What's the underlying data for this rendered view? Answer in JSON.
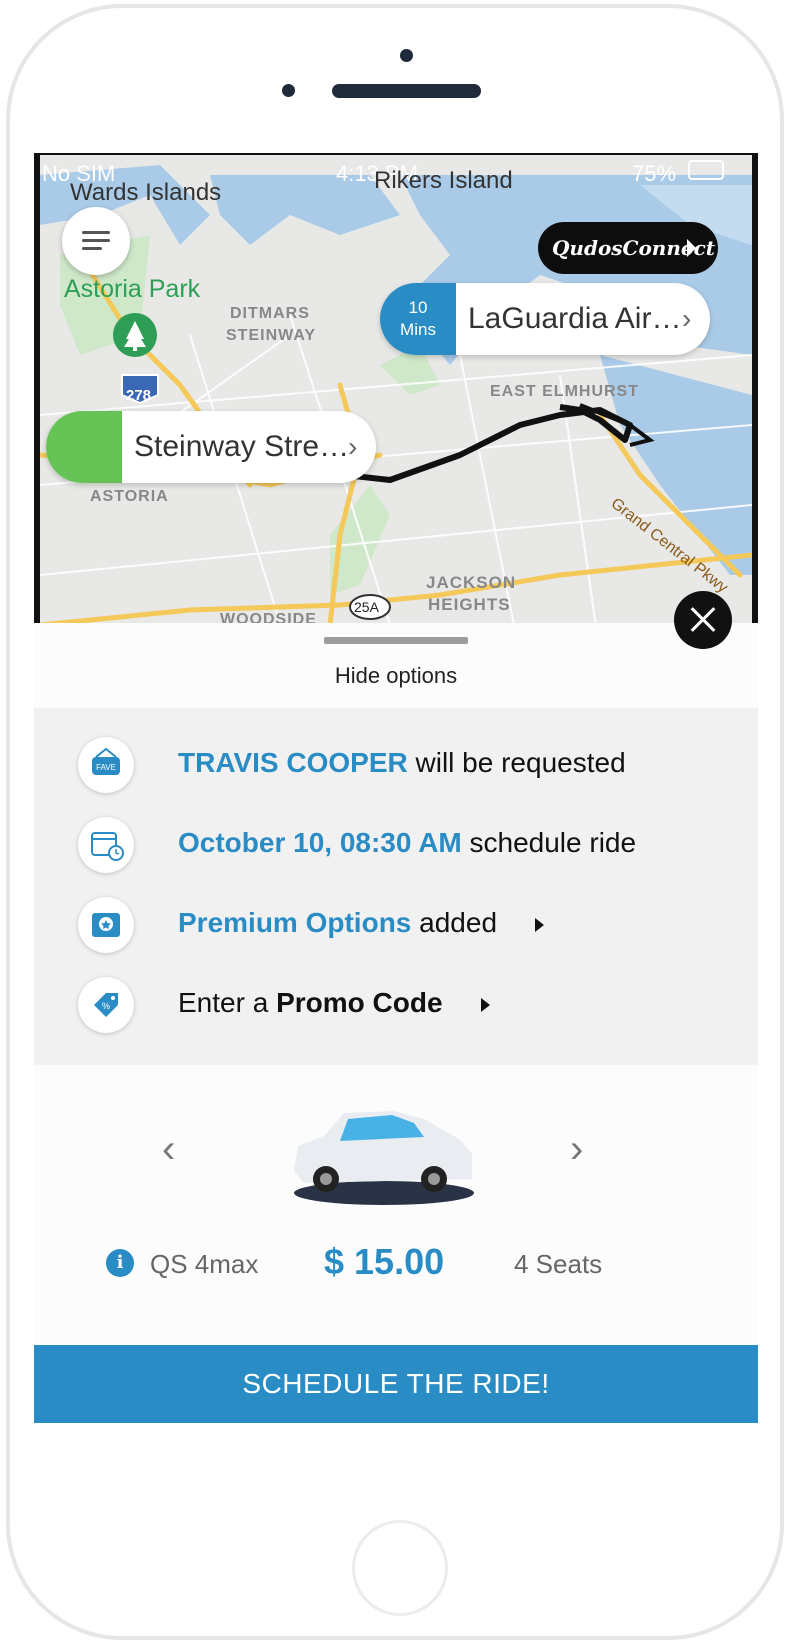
{
  "status_bar": {
    "carrier": "No SIM",
    "time": "4:13 PM",
    "battery": "75%"
  },
  "map": {
    "labels": {
      "wards_islands": "Wards Islands",
      "rikers_island": "Rikers Island",
      "astoria_park": "Astoria Park",
      "ditmars": "DITMARS",
      "steinway": "STEINWAY",
      "east_elmhurst": "EAST ELMHURST",
      "astoria": "ASTORIA",
      "jackson": "JACKSON",
      "heights": "HEIGHTS",
      "woodside": "WOODSIDE",
      "highway_278": "278",
      "highway_25a": "25A",
      "grand_central": "Grand Central Pkwy"
    },
    "brand_button": "QudosConnect",
    "destination": {
      "eta_value": "10",
      "eta_unit": "Mins",
      "label": "LaGuardia Air…"
    },
    "origin": {
      "label": "Steinway Stre…"
    },
    "colors": {
      "origin_cap": "#66c457",
      "destination_cap": "#2a8cc4",
      "water": "#a9cbe8",
      "road": "#f4c95a"
    }
  },
  "sheet": {
    "hide_label": "Hide options",
    "options": [
      {
        "highlight": "TRAVIS COOPER",
        "rest": "will be requested",
        "icon": "fave-driver-icon"
      },
      {
        "highlight": "October 10, 08:30 AM",
        "rest": "schedule ride",
        "icon": "calendar-clock-icon"
      },
      {
        "highlight": "Premium Options",
        "rest": "added",
        "icon": "premium-badge-icon"
      },
      {
        "prefix": "Enter a",
        "bold": "Promo Code",
        "icon": "promo-tag-icon"
      }
    ],
    "vehicle": {
      "model": "QS 4max",
      "price": "$ 15.00",
      "seats": "4 Seats"
    },
    "cta": "SCHEDULE THE RIDE!"
  },
  "colors": {
    "accent": "#2a8cc4",
    "text": "#111111"
  }
}
